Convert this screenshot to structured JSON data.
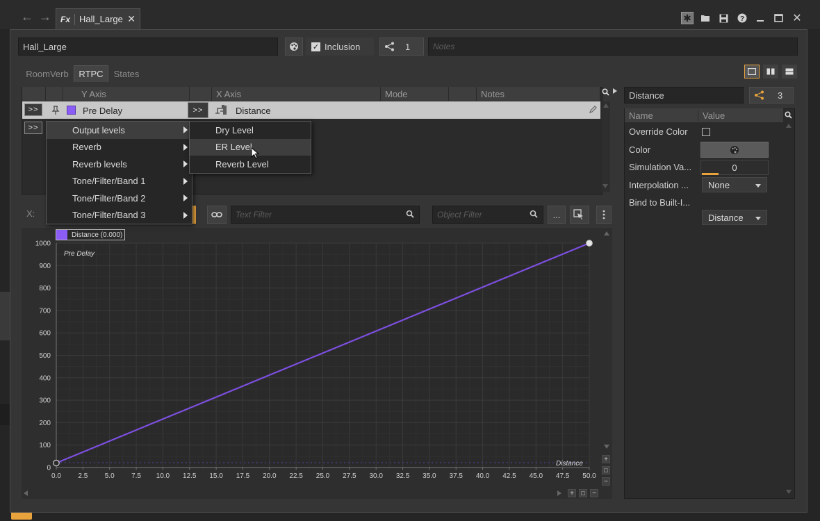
{
  "window": {
    "tab_icon": "Fx",
    "tab_title": "Hall_Large"
  },
  "toolbar": {
    "object_name": "Hall_Large",
    "inclusion_label": "Inclusion",
    "inclusion_checked": true,
    "reference_count": "1",
    "notes_placeholder": "Notes"
  },
  "subtabs": [
    "RoomVerb",
    "RTPC",
    "States"
  ],
  "active_subtab": "RTPC",
  "rtpc_table": {
    "headers": [
      "Y Axis",
      "X Axis",
      "Mode",
      "Notes"
    ],
    "row": {
      "expand_label": ">>",
      "y_axis": "Pre Delay",
      "x_axis_btn": ">>",
      "x_axis": "Distance",
      "color": "#8b5cf6"
    },
    "new_row_btn": ">>"
  },
  "context_menu": {
    "items": [
      "Output levels",
      "Reverb",
      "Reverb levels",
      "Tone/Filter/Band 1",
      "Tone/Filter/Band 2",
      "Tone/Filter/Band 3"
    ],
    "highlighted": "Output levels",
    "submenu": {
      "items": [
        "Dry Level",
        "ER Level",
        "Reverb Level"
      ],
      "highlighted": "ER Level"
    }
  },
  "filter_bar": {
    "x_label": "X:",
    "text_filter_placeholder": "Text Filter",
    "object_filter_placeholder": "Object Filter",
    "more_label": "..."
  },
  "right_panel": {
    "title": "Distance",
    "ref_count": "3",
    "headers": {
      "name": "Name",
      "value": "Value"
    },
    "properties": [
      {
        "name": "Override Color",
        "kind": "checkbox"
      },
      {
        "name": "Color",
        "kind": "color"
      },
      {
        "name": "Simulation Va...",
        "kind": "slider",
        "value": "0"
      },
      {
        "name": "Interpolation ...",
        "kind": "combo",
        "value": "None"
      },
      {
        "name": "Bind to Built-I...",
        "kind": "combo",
        "value": "Distance"
      }
    ]
  },
  "chart_data": {
    "type": "line",
    "legend": "Distance (0.000)",
    "ylabel": "Pre Delay",
    "xlabel": "Distance",
    "xlim": [
      0,
      50
    ],
    "ylim": [
      0,
      1000
    ],
    "x_ticks": [
      "0.0",
      "2.5",
      "5.0",
      "7.5",
      "10.0",
      "12.5",
      "15.0",
      "17.5",
      "20.0",
      "22.5",
      "25.0",
      "27.5",
      "30.0",
      "32.5",
      "35.0",
      "37.5",
      "40.0",
      "42.5",
      "45.0",
      "47.5",
      "50.0"
    ],
    "y_ticks": [
      "0",
      "100",
      "200",
      "300",
      "400",
      "500",
      "600",
      "700",
      "800",
      "900",
      "1000"
    ],
    "grid": true,
    "series": [
      {
        "name": "Pre Delay",
        "color": "#7d4fe0",
        "points": [
          [
            0,
            20
          ],
          [
            50,
            1000
          ]
        ]
      }
    ]
  },
  "colors": {
    "accent": "#8b5cf6",
    "orange": "#e8a33d"
  }
}
